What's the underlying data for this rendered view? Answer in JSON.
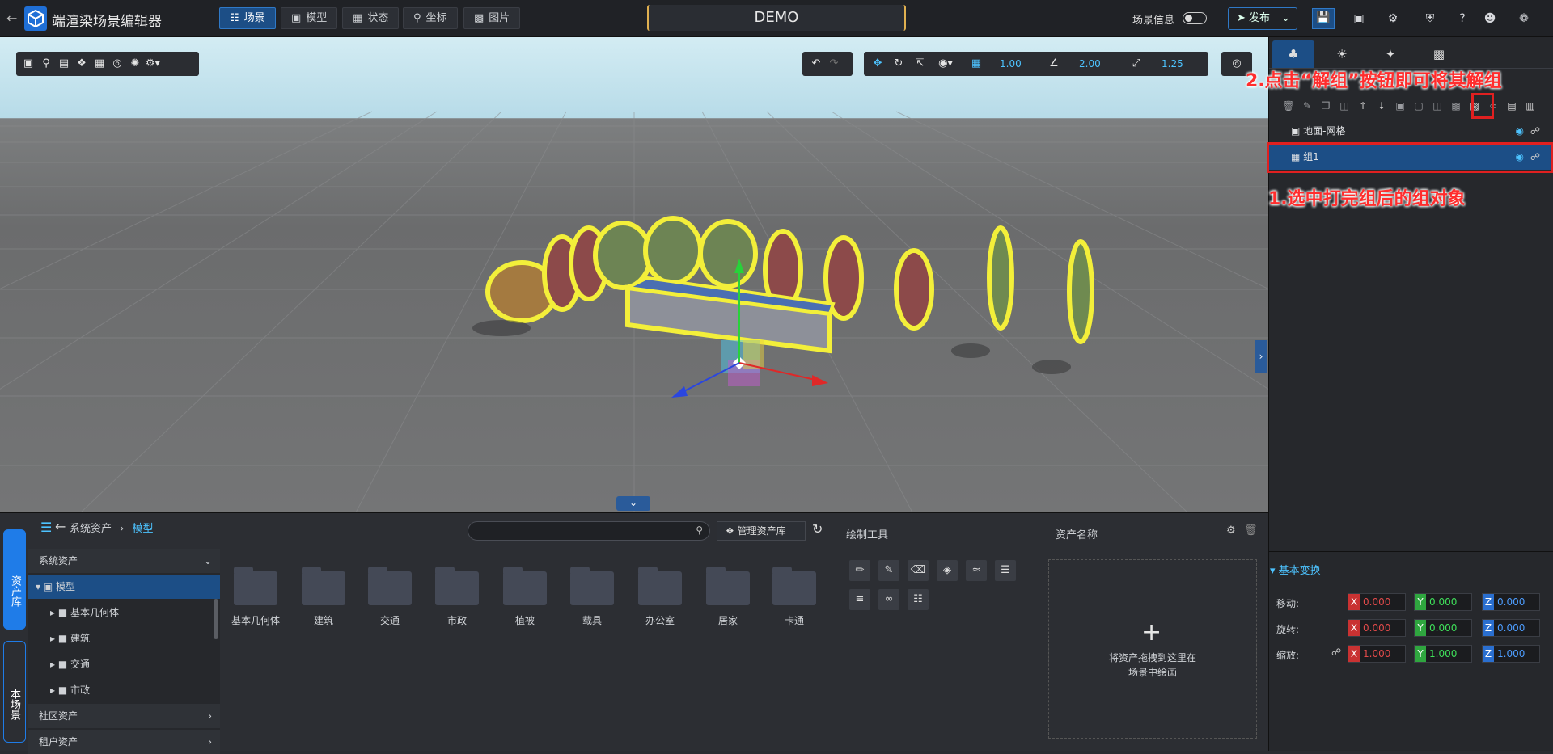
{
  "app": {
    "title": "端渲染场景编辑器",
    "demo": "DEMO"
  },
  "nav_tabs": [
    {
      "label": "场景",
      "icon": "layers-icon"
    },
    {
      "label": "模型",
      "icon": "cube-icon"
    },
    {
      "label": "状态",
      "icon": "grid-icon"
    },
    {
      "label": "坐标",
      "icon": "pin-icon"
    },
    {
      "label": "图片",
      "icon": "image-icon"
    }
  ],
  "top_right": {
    "scene_info": "场景信息",
    "publish": "发布"
  },
  "viewport": {
    "grid_value": "1.00",
    "angle_value": "2.00",
    "scale_value": "1.25"
  },
  "assets": {
    "breadcrumb_root": "系统资产",
    "breadcrumb_current": "模型",
    "manage_label": "管理资产库",
    "side_tabs": [
      "资产库",
      "本场景"
    ],
    "tree_header": "系统资产",
    "tree_root": "模型",
    "tree_children": [
      "基本几何体",
      "建筑",
      "交通",
      "市政"
    ],
    "community": "社区资产",
    "tenant": "租户资产",
    "folders": [
      "基本几何体",
      "建筑",
      "交通",
      "市政",
      "植被",
      "载具",
      "办公室",
      "居家",
      "卡通"
    ]
  },
  "draw_tools": {
    "title": "绘制工具"
  },
  "asset_name": {
    "title": "资产名称",
    "drop_text_1": "将资产拖拽到这里在",
    "drop_text_2": "场景中绘画"
  },
  "layers": [
    {
      "name": "地面-网格"
    },
    {
      "name": "组1"
    }
  ],
  "transform": {
    "title": "基本变换",
    "move_label": "移动:",
    "rotate_label": "旋转:",
    "scale_label": "缩放:",
    "move": {
      "x": "0.000",
      "y": "0.000",
      "z": "0.000"
    },
    "rotate": {
      "x": "0.000",
      "y": "0.000",
      "z": "0.000"
    },
    "scale": {
      "x": "1.000",
      "y": "1.000",
      "z": "1.000"
    }
  },
  "annotations": {
    "step2": "2.点击“解组”按钮即可将其解组",
    "step1": "1.选中打完组后的组对象"
  }
}
